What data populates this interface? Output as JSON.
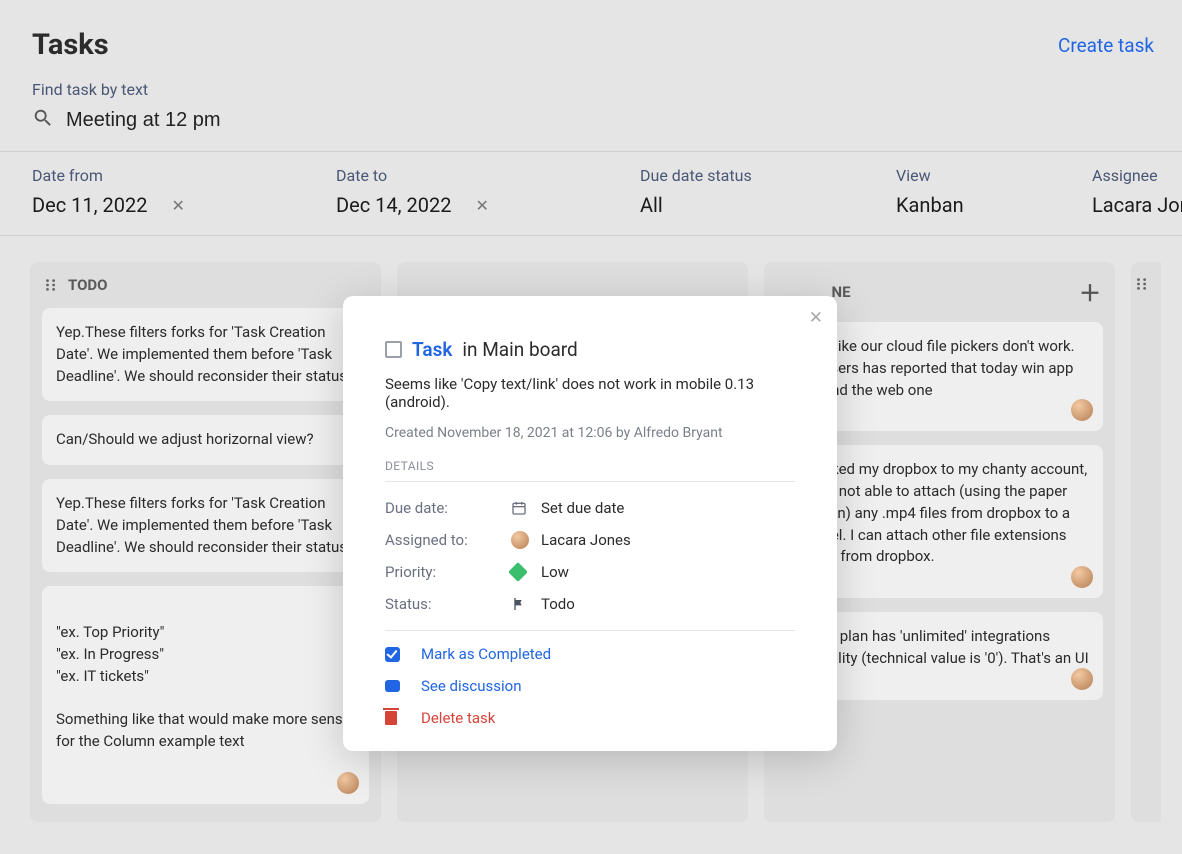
{
  "header": {
    "title": "Tasks",
    "create": "Create task"
  },
  "search": {
    "label": "Find task by text",
    "value": "Meeting at 12 pm"
  },
  "filters": {
    "date_from": {
      "label": "Date from",
      "value": "Dec 11, 2022"
    },
    "date_to": {
      "label": "Date to",
      "value": "Dec 14, 2022"
    },
    "due_status": {
      "label": "Due date status",
      "value": "All"
    },
    "view": {
      "label": "View",
      "value": "Kanban"
    },
    "assignee": {
      "label": "Assignee",
      "value": "Lacara Jones"
    }
  },
  "columns": {
    "todo": {
      "title": "TODO",
      "cards": [
        "Yep.These filters forks for 'Task Creation Date'. We implemented them before 'Task Deadline'. We should reconsider their status.",
        "Can/Should we adjust horizornal view?",
        "Yep.These filters forks for 'Task Creation Date'. We implemented them before 'Task Deadline'. We should reconsider their status.",
        "\"ex. Top Priority\"\n\"ex. In Progress\"\n\"ex. IT tickets\"\n\nSomething like that would make more sense for the Column example text"
      ]
    },
    "done": {
      "title_suffix": "NE",
      "cards": [
        "Looks like our cloud file pickers don't work. Two users has reported that today win app 12.8 and the web one",
        "I've linked my dropbox to my chanty account, but I'm not able to attach (using the paper clip icon) any .mp4 files from dropbox to a channel. I can attach other file extensions though from dropbox.",
        "Free to plan has 'unlimited' integrations possibility (technical value is '0'). That's an UI"
      ]
    }
  },
  "modal": {
    "type_label": "Task",
    "in_board": "in Main board",
    "description": "Seems like 'Copy text/link' does not work in mobile 0.13 (android).",
    "created": "Created November 18, 2021 at 12:06 by Alfredo Bryant",
    "details_header": "DETAILS",
    "rows": {
      "due_date": {
        "label": "Due date:",
        "value": "Set due date"
      },
      "assigned": {
        "label": "Assigned to:",
        "value": "Lacara Jones"
      },
      "priority": {
        "label": "Priority:",
        "value": "Low"
      },
      "status": {
        "label": "Status:",
        "value": "Todo"
      }
    },
    "actions": {
      "complete": "Mark as Completed",
      "discussion": "See discussion",
      "delete": "Delete task"
    }
  }
}
